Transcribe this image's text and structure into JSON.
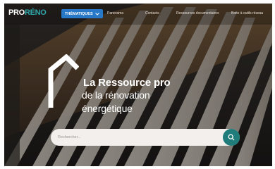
{
  "header": {
    "logo_part1": "PRO",
    "logo_part2": "RÉNO",
    "themes_label": "THÉMATIQUES",
    "nav": [
      "Panorama",
      "Contacts",
      "Ressources documentaires",
      "Boite à outils réseau"
    ]
  },
  "hero": {
    "line1": "La Ressource pro",
    "line2": "de la rénovation",
    "line3": "énergétique"
  },
  "search": {
    "placeholder": "Rechercher..."
  },
  "colors": {
    "accent_blue": "#2878c8",
    "accent_teal": "#1f7c7a",
    "logo_teal": "#2fa6a9"
  }
}
